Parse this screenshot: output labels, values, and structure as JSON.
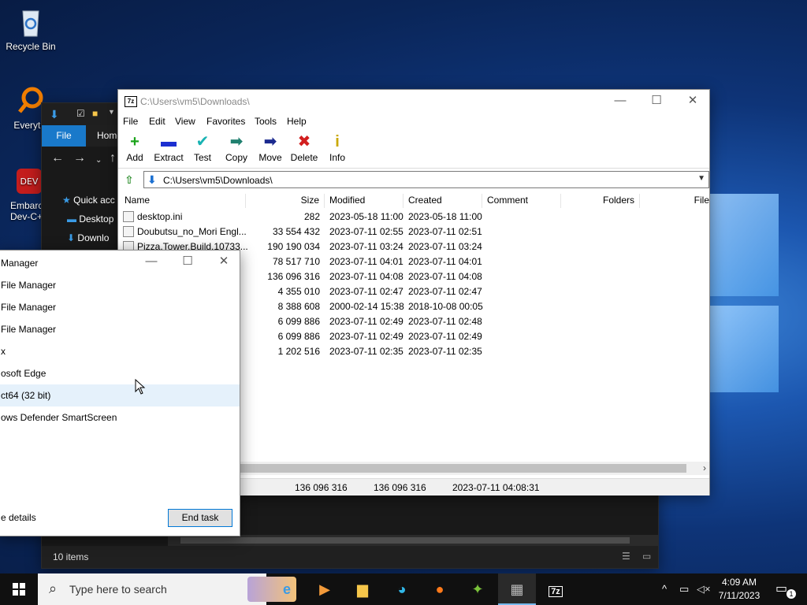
{
  "desktop": {
    "icons": [
      {
        "name": "Recycle Bin"
      },
      {
        "name": "Everythi"
      },
      {
        "name": "Embarca Dev-C++"
      }
    ]
  },
  "explorer": {
    "file_tab": "File",
    "home_tab": "Home",
    "nav": [
      {
        "label": "Quick acc"
      },
      {
        "label": "Desktop"
      },
      {
        "label": "Downlo"
      }
    ],
    "status_count": "10 items"
  },
  "sevenzip": {
    "title": "C:\\Users\\vm5\\Downloads\\",
    "app_icon_text": "7z",
    "menu": [
      "File",
      "Edit",
      "View",
      "Favorites",
      "Tools",
      "Help"
    ],
    "toolbar": [
      {
        "label": "Add",
        "icon": "+",
        "color": "#1aa31a"
      },
      {
        "label": "Extract",
        "icon": "▬",
        "color": "#1c2fd1"
      },
      {
        "label": "Test",
        "icon": "✔",
        "color": "#19b3b3"
      },
      {
        "label": "Copy",
        "icon": "➡",
        "color": "#20806f"
      },
      {
        "label": "Move",
        "icon": "➡",
        "color": "#1b2a8f"
      },
      {
        "label": "Delete",
        "icon": "✖",
        "color": "#d21f1f"
      },
      {
        "label": "Info",
        "icon": "i",
        "color": "#c9a800"
      }
    ],
    "address": "C:\\Users\\vm5\\Downloads\\",
    "columns": [
      "Name",
      "Size",
      "Modified",
      "Created",
      "Comment",
      "Folders",
      "File"
    ],
    "rows": [
      {
        "name": "desktop.ini",
        "size": "282",
        "modified": "2023-05-18 11:00",
        "created": "2023-05-18 11:00"
      },
      {
        "name": "Doubutsu_no_Mori Engl...",
        "size": "33 554 432",
        "modified": "2023-07-11 02:55",
        "created": "2023-07-11 02:51"
      },
      {
        "name": "Pizza.Tower.Build.10733...",
        "size": "190 190 034",
        "modified": "2023-07-11 03:24",
        "created": "2023-07-11 03:24"
      },
      {
        "name": "",
        "size": "78 517 710",
        "modified": "2023-07-11 04:01",
        "created": "2023-07-11 04:01"
      },
      {
        "name": "",
        "size": "136 096 316",
        "modified": "2023-07-11 04:08",
        "created": "2023-07-11 04:08"
      },
      {
        "name": "",
        "size": "4 355 010",
        "modified": "2023-07-11 02:47",
        "created": "2023-07-11 02:47"
      },
      {
        "name": "",
        "size": "8 388 608",
        "modified": "2000-02-14 15:38",
        "created": "2018-10-08 00:05"
      },
      {
        "name": "",
        "size": "6 099 886",
        "modified": "2023-07-11 02:49",
        "created": "2023-07-11 02:48"
      },
      {
        "name": "",
        "size": "6 099 886",
        "modified": "2023-07-11 02:49",
        "created": "2023-07-11 02:49"
      },
      {
        "name": "",
        "size": "1 202 516",
        "modified": "2023-07-11 02:35",
        "created": "2023-07-11 02:35"
      }
    ],
    "status": {
      "size": "136 096 316",
      "packed": "136 096 316",
      "modified": "2023-07-11 04:08:31"
    }
  },
  "taskman": {
    "title": "Manager",
    "items": [
      "File Manager",
      "File Manager",
      "File Manager",
      "x",
      "osoft Edge",
      "ct64 (32 bit)",
      "ows Defender SmartScreen"
    ],
    "details_label": "e details",
    "end_task_label": "End task"
  },
  "taskbar": {
    "search_placeholder": "Type here to search",
    "time": "4:09 AM",
    "date": "7/11/2023",
    "notification_count": "1"
  }
}
